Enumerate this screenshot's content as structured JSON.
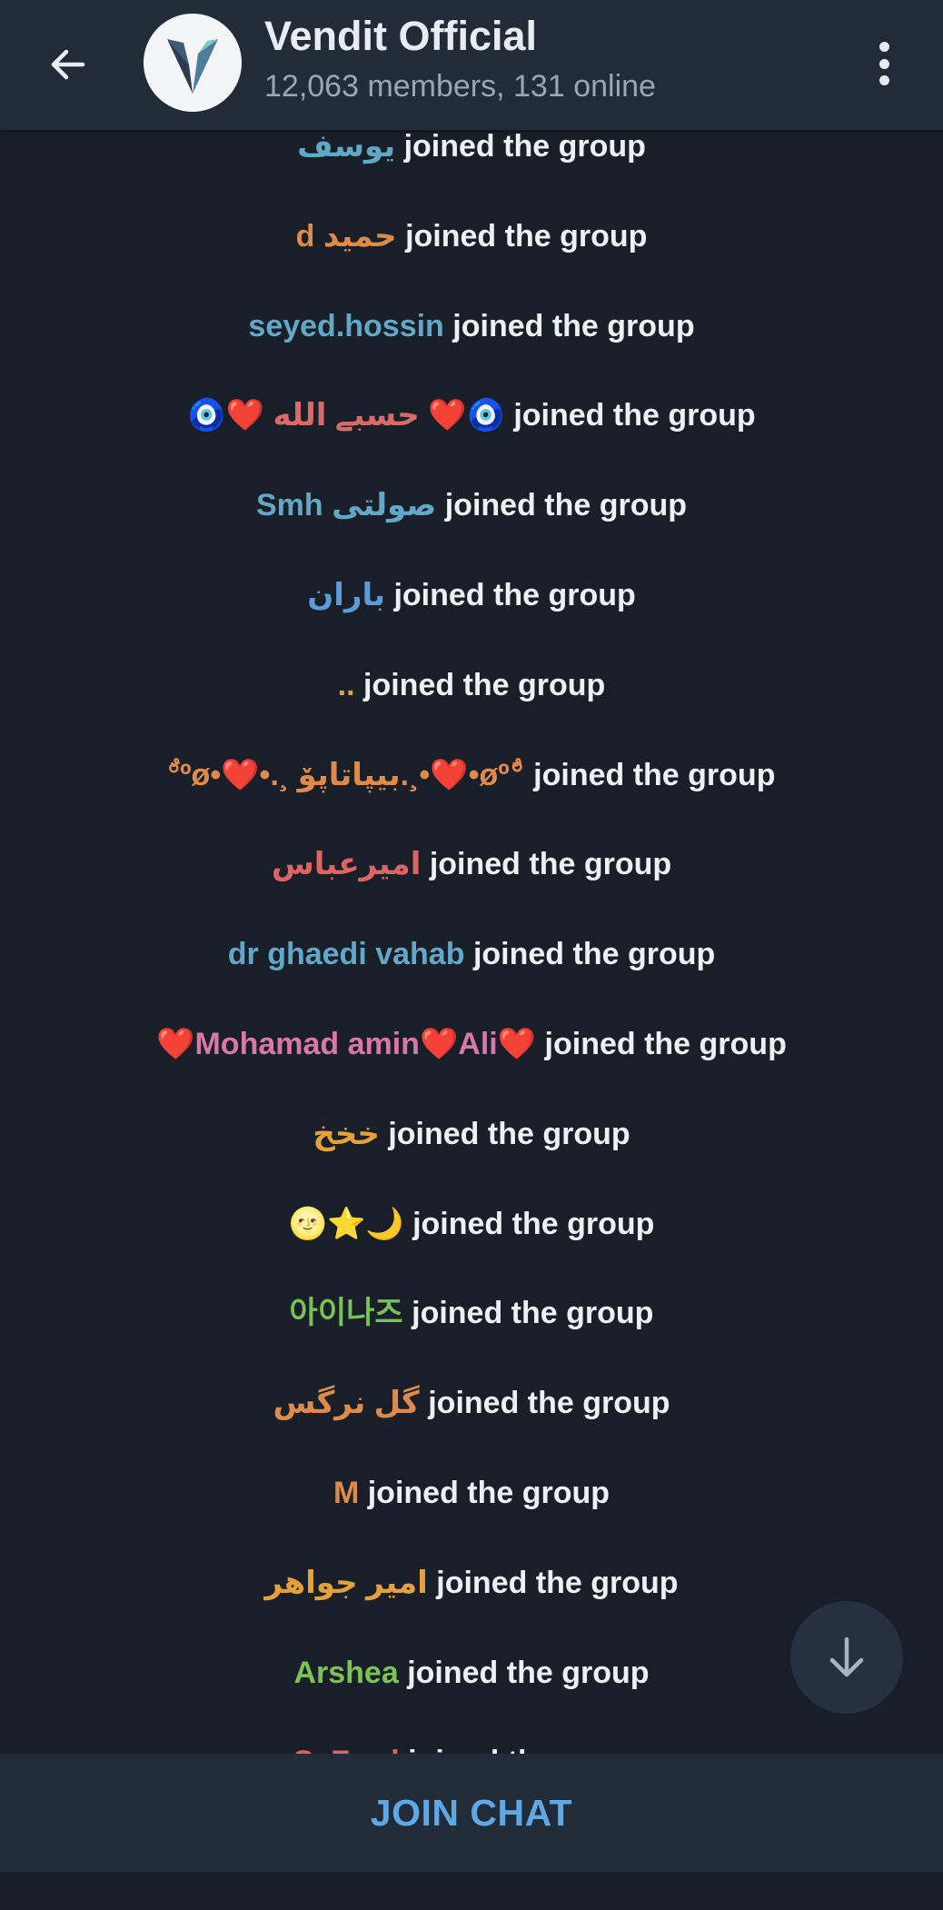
{
  "header": {
    "title": "Vendit Official",
    "subtitle": "12,063 members, 131 online",
    "icons": {
      "back": "arrow-left-icon",
      "menu": "more-vertical-icon",
      "avatar": "vendit-logo"
    }
  },
  "join_suffix": "joined the group",
  "messages": [
    {
      "name": "یوسف",
      "color": "#5ea9c5"
    },
    {
      "name": "حمید d",
      "color": "#e08a4a"
    },
    {
      "name": "seyed.hossin",
      "color": "#62a8c6"
    },
    {
      "name": "🧿❤️ حسبے الله ❤️🧿",
      "color": "#d96a6a"
    },
    {
      "name": "Smh صولتی",
      "color": "#62a8c6"
    },
    {
      "name": "باران",
      "color": "#5b9bd8"
    },
    {
      "name": "..",
      "color": "#e3a03b"
    },
    {
      "name": "ٌ°ºø•❤️•.¸ بیپاتاپۆ.¸•❤️•øº°ٌ",
      "color": "#e08a4a"
    },
    {
      "name": "امیرعباس",
      "color": "#e06363"
    },
    {
      "name": "dr ghaedi vahab",
      "color": "#62a8c6"
    },
    {
      "name": "❤️Mohamad amin❤️Ali❤️",
      "color": "#d878a8"
    },
    {
      "name": "خخخ",
      "color": "#e3a03b"
    },
    {
      "name": "🌝⭐🌙",
      "color": "#e3a03b"
    },
    {
      "name": "아이나즈",
      "color": "#7bc156"
    },
    {
      "name": "گل نرگس",
      "color": "#e08a4a"
    },
    {
      "name": "M",
      "color": "#e08a4a"
    },
    {
      "name": "امیر جواهر",
      "color": "#e3a03b"
    },
    {
      "name": "Arshea",
      "color": "#7bc156"
    },
    {
      "name": "S. Ford",
      "color": "#e06363"
    }
  ],
  "join_button": {
    "label": "JOIN CHAT"
  },
  "scroll_button": {
    "icon": "arrow-down-icon"
  },
  "colors": {
    "background": "#181f28",
    "header": "#222c38",
    "accent": "#5fa8e8"
  }
}
